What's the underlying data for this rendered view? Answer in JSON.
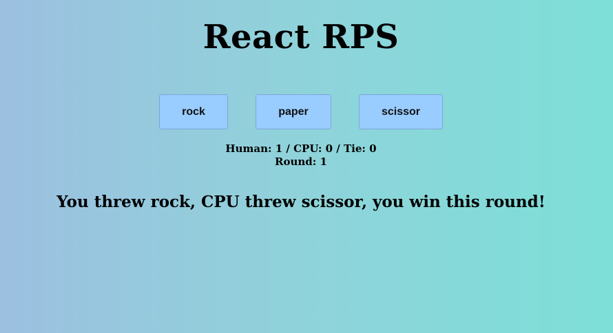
{
  "app": {
    "title": "React RPS"
  },
  "controls": {
    "rock_label": "rock",
    "paper_label": "paper",
    "scissor_label": "scissor"
  },
  "scoreboard": {
    "line1": "Human: 1 / CPU: 0 / Tie: 0",
    "line2": "Round: 1"
  },
  "result": {
    "message": "You threw rock, CPU threw scissor, you win this round!"
  },
  "colors": {
    "button_bg": "#99ccff",
    "gradient_left": "#9cc0e0",
    "gradient_right": "#7ddfd8"
  }
}
